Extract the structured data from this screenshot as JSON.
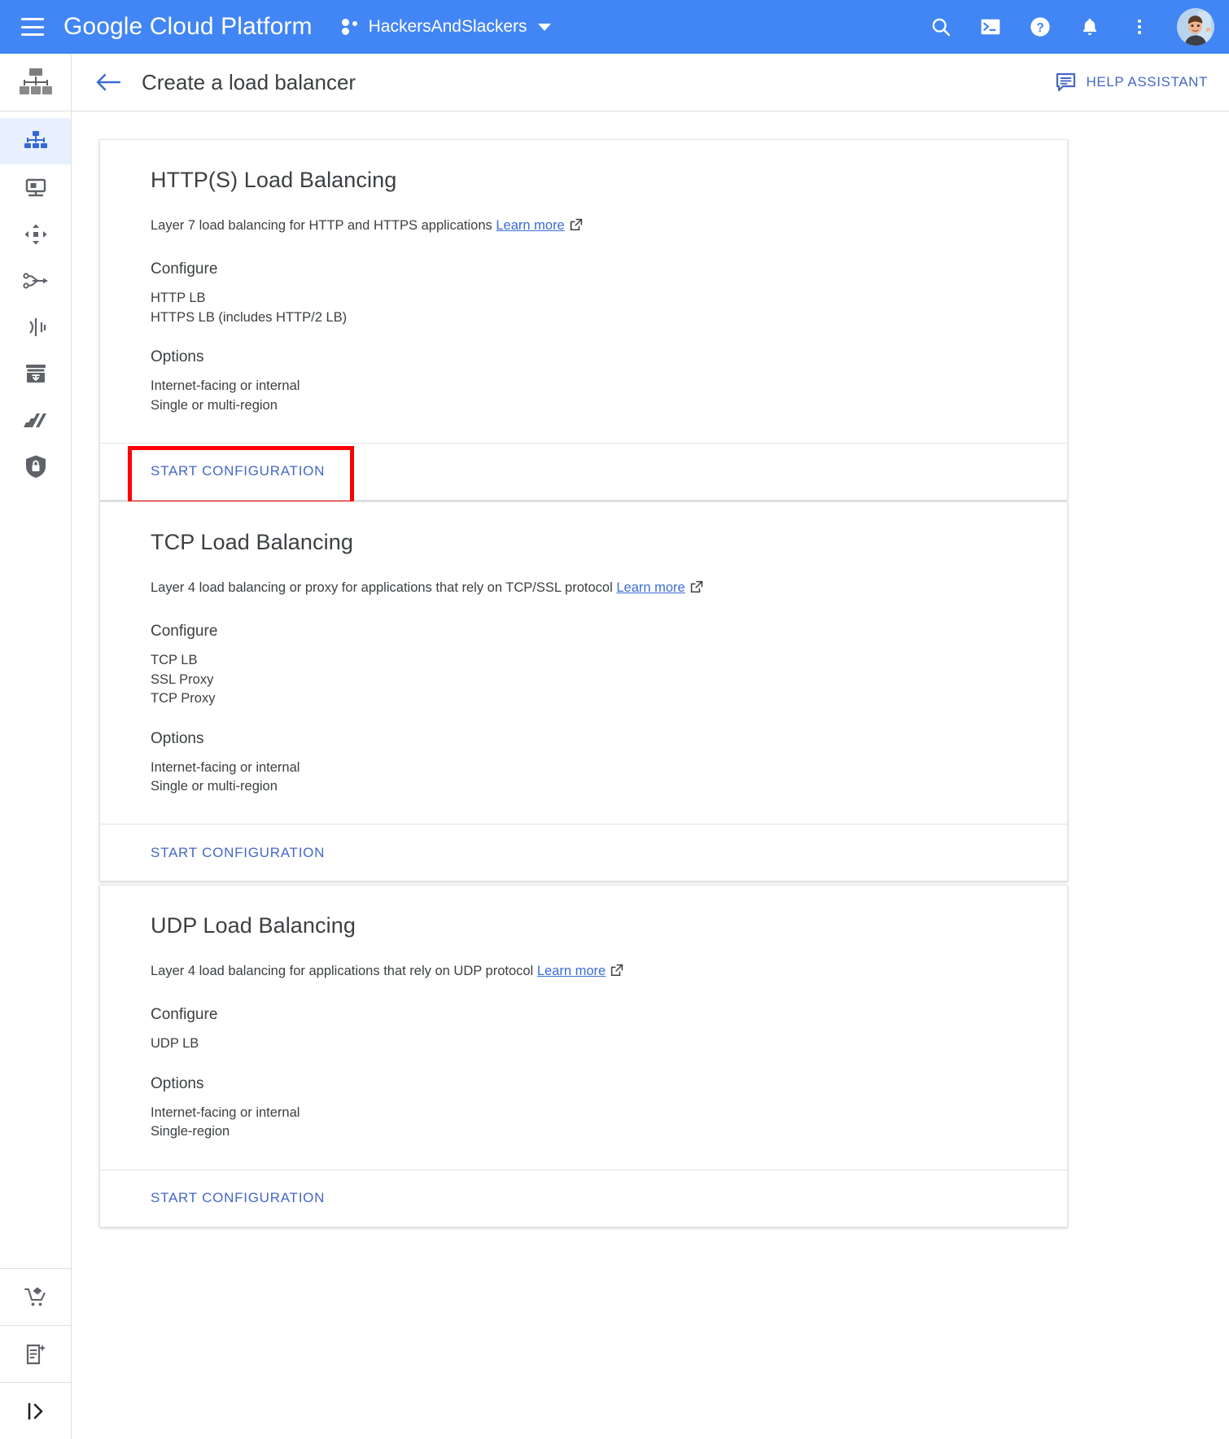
{
  "topbar": {
    "menu_icon": "hamburger-menu-icon",
    "brand": "Google Cloud Platform",
    "project": "HackersAndSlackers",
    "project_picker_icon": "project-dots-icon",
    "dropdown_icon": "chevron-down-icon",
    "actions": [
      {
        "name": "search-icon",
        "label": "Search"
      },
      {
        "name": "cloud-shell-icon",
        "label": "Activate Cloud Shell"
      },
      {
        "name": "help-icon",
        "label": "Help"
      },
      {
        "name": "notifications-icon",
        "label": "Notifications"
      },
      {
        "name": "more-options-icon",
        "label": "More options"
      }
    ],
    "avatar_label": "Account"
  },
  "subbar": {
    "back_icon": "back-arrow-icon",
    "title": "Create a load balancer",
    "help_assistant_icon": "chat-bubble-icon",
    "help_assistant_label": "HELP ASSISTANT"
  },
  "rail": {
    "logo_icon": "network-services-logo-icon",
    "items": [
      {
        "name": "sidebar-item-load-balancing",
        "icon": "load-balancing-icon",
        "active": true
      },
      {
        "name": "sidebar-item-backends",
        "icon": "server-monitor-icon",
        "active": false
      },
      {
        "name": "sidebar-item-network-endpoint-groups",
        "icon": "move-arrows-icon",
        "active": false
      },
      {
        "name": "sidebar-item-traffic-director",
        "icon": "traffic-director-icon",
        "active": false
      },
      {
        "name": "sidebar-item-cloud-dns",
        "icon": "dns-fork-icon",
        "active": false
      },
      {
        "name": "sidebar-item-cloud-cdn",
        "icon": "archive-box-icon",
        "active": false
      },
      {
        "name": "sidebar-item-cloud-nat",
        "icon": "bars-chart-icon",
        "active": false
      },
      {
        "name": "sidebar-item-cloud-armor",
        "icon": "shield-lock-icon",
        "active": false
      }
    ],
    "bottom_items": [
      {
        "name": "sidebar-item-marketplace",
        "icon": "shopping-cart-icon"
      },
      {
        "name": "sidebar-item-release-notes",
        "icon": "document-sparkle-icon"
      },
      {
        "name": "sidebar-expand-button",
        "icon": "expand-panel-icon"
      }
    ]
  },
  "cards": [
    {
      "id": "http-load-balancing",
      "title": "HTTP(S) Load Balancing",
      "desc_text": "Layer 7 load balancing for HTTP and HTTPS applications",
      "link_label": "Learn more",
      "link_icon": "open-in-new-icon",
      "configure_heading": "Configure",
      "configure_items": [
        "HTTP LB",
        "HTTPS LB (includes HTTP/2 LB)"
      ],
      "options_heading": "Options",
      "options_items": [
        "Internet-facing or internal",
        "Single or multi-region"
      ],
      "start_label": "START CONFIGURATION",
      "highlighted": true
    },
    {
      "id": "tcp-load-balancing",
      "title": "TCP Load Balancing",
      "desc_text": "Layer 4 load balancing or proxy for applications that rely on TCP/SSL protocol",
      "link_label": "Learn more",
      "link_icon": "open-in-new-icon",
      "configure_heading": "Configure",
      "configure_items": [
        "TCP LB",
        "SSL Proxy",
        "TCP Proxy"
      ],
      "options_heading": "Options",
      "options_items": [
        "Internet-facing or internal",
        "Single or multi-region"
      ],
      "start_label": "START CONFIGURATION",
      "highlighted": false
    },
    {
      "id": "udp-load-balancing",
      "title": "UDP Load Balancing",
      "desc_text": "Layer 4 load balancing for applications that rely on UDP protocol",
      "link_label": "Learn more",
      "link_icon": "open-in-new-icon",
      "configure_heading": "Configure",
      "configure_items": [
        "UDP LB"
      ],
      "options_heading": "Options",
      "options_items": [
        "Internet-facing or internal",
        "Single-region"
      ],
      "start_label": "START CONFIGURATION",
      "highlighted": false
    }
  ],
  "colors": {
    "header_blue": "#4285f4",
    "link_blue": "#4668c5",
    "text": "#3c4043",
    "highlight_red": "#fe0000",
    "active_rail": "#e8f0fe"
  }
}
